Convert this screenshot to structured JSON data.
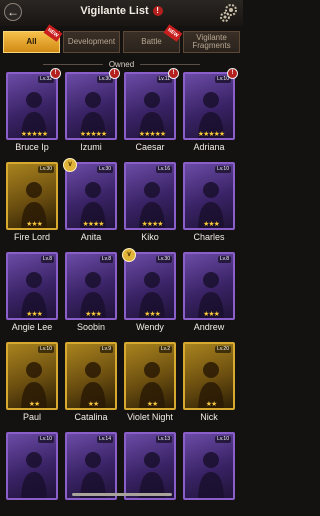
{
  "header": {
    "title": "Vigilante List",
    "info": "!"
  },
  "tabs": [
    {
      "label": "All",
      "active": true,
      "new": true
    },
    {
      "label": "Development",
      "active": false,
      "new": false
    },
    {
      "label": "Battle",
      "active": false,
      "new": true
    },
    {
      "label": "Vigilante Fragments",
      "active": false,
      "new": false
    }
  ],
  "new_badge": "NEW",
  "section": {
    "label": "Owned"
  },
  "cards": [
    {
      "name": "Bruce Ip",
      "level": "Lv.32",
      "stars": "★★★★★",
      "frame": "purple",
      "alert": true
    },
    {
      "name": "Izumi",
      "level": "Lv.30",
      "stars": "★★★★★",
      "frame": "purple",
      "alert": true
    },
    {
      "name": "Caesar",
      "level": "Lv.11",
      "stars": "★★★★★",
      "frame": "purple",
      "alert": true
    },
    {
      "name": "Adriana",
      "level": "Lv.10",
      "stars": "★★★★★",
      "frame": "purple",
      "alert": true
    },
    {
      "name": "Fire Lord",
      "level": "Lv.30",
      "stars": "★★★",
      "frame": "gold"
    },
    {
      "name": "Anita",
      "level": "Lv.30",
      "stars": "★★★★",
      "frame": "purple",
      "rank": true
    },
    {
      "name": "Kiko",
      "level": "Lv.16",
      "stars": "★★★★",
      "frame": "purple"
    },
    {
      "name": "Charles",
      "level": "Lv.10",
      "stars": "★★★",
      "frame": "purple"
    },
    {
      "name": "Angie Lee",
      "level": "Lv.8",
      "stars": "★★★",
      "frame": "purple"
    },
    {
      "name": "Soobin",
      "level": "Lv.8",
      "stars": "★★★",
      "frame": "purple"
    },
    {
      "name": "Wendy",
      "level": "Lv.30",
      "stars": "★★★",
      "frame": "purple",
      "rank": true
    },
    {
      "name": "Andrew",
      "level": "Lv.8",
      "stars": "★★★",
      "frame": "purple"
    },
    {
      "name": "Paul",
      "level": "Lv.10",
      "stars": "★★",
      "frame": "gold"
    },
    {
      "name": "Catalina",
      "level": "Lv.9",
      "stars": "★★",
      "frame": "gold"
    },
    {
      "name": "Violet Night",
      "level": "Lv.2",
      "stars": "★★",
      "frame": "gold"
    },
    {
      "name": "Nick",
      "level": "Lv.20",
      "stars": "★★",
      "frame": "gold"
    },
    {
      "name": "",
      "level": "Lv.10",
      "stars": "",
      "frame": "purple"
    },
    {
      "name": "",
      "level": "Lv.14",
      "stars": "",
      "frame": "purple"
    },
    {
      "name": "",
      "level": "Lv.13",
      "stars": "",
      "frame": "purple"
    },
    {
      "name": "",
      "level": "Lv.10",
      "stars": "",
      "frame": "purple"
    }
  ]
}
